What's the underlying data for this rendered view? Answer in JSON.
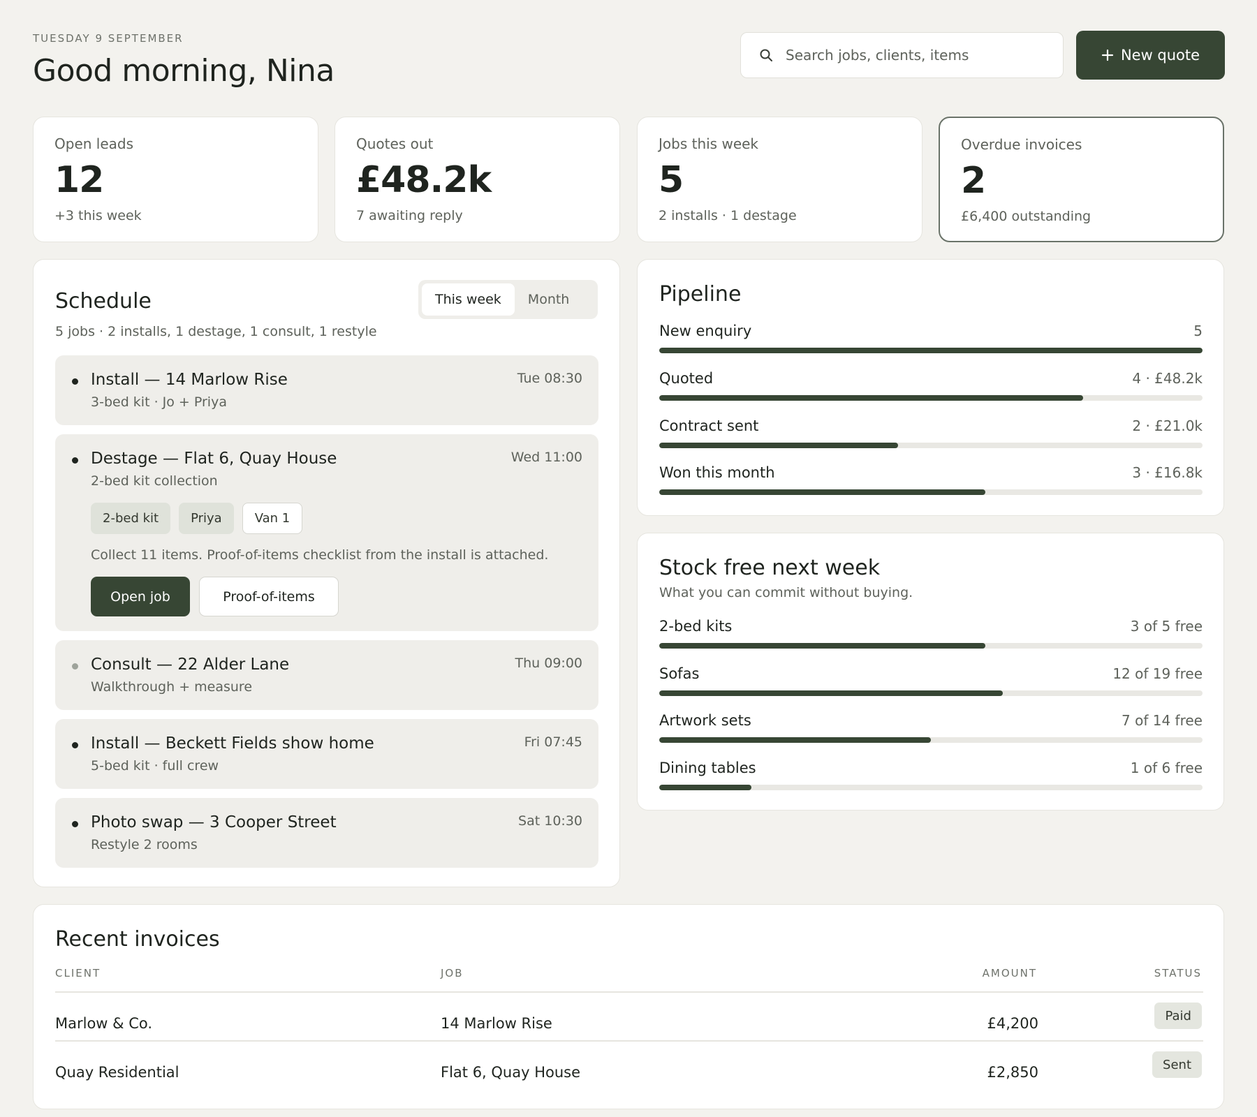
{
  "header": {
    "date": "TUESDAY 9 SEPTEMBER",
    "greeting": "Good morning, Nina",
    "search_placeholder": "Search jobs, clients, items",
    "new_quote_label": "New quote"
  },
  "stats": [
    {
      "label": "Open leads",
      "value": "12",
      "sub": "+3 this week"
    },
    {
      "label": "Quotes out",
      "value": "£48.2k",
      "sub": "7 awaiting reply"
    },
    {
      "label": "Jobs this week",
      "value": "5",
      "sub": "2 installs · 1 destage"
    },
    {
      "label": "Overdue invoices",
      "value": "2",
      "sub": "£6,400 outstanding"
    }
  ],
  "schedule": {
    "title": "Schedule",
    "summary": "5 jobs · 2 installs, 1 destage, 1 consult, 1 restyle",
    "tabs": [
      "This week",
      "Month"
    ],
    "jobs": [
      {
        "title": "Install — 14 Marlow Rise",
        "detail": "3-bed kit · Jo + Priya",
        "time": "Tue 08:30"
      },
      {
        "title": "Destage — Flat 6, Quay House",
        "detail": "2-bed kit collection",
        "time": "Wed 11:00",
        "chips": [
          "2-bed kit",
          "Priya",
          "Van 1"
        ],
        "note": "Collect 11 items. Proof-of-items checklist from the install is attached.",
        "actions": [
          "Open job",
          "Proof-of-items"
        ]
      },
      {
        "title": "Consult — 22 Alder Lane",
        "detail": "Walkthrough + measure",
        "time": "Thu 09:00"
      },
      {
        "title": "Install — Beckett Fields show home",
        "detail": "5-bed kit · full crew",
        "time": "Fri 07:45"
      },
      {
        "title": "Photo swap — 3 Cooper Street",
        "detail": "Restyle 2 rooms",
        "time": "Sat 10:30"
      }
    ]
  },
  "pipeline": {
    "title": "Pipeline",
    "rows": [
      {
        "label": "New enquiry",
        "value": "5",
        "fraction": 1.0
      },
      {
        "label": "Quoted",
        "value": "4 · £48.2k",
        "fraction": 0.78
      },
      {
        "label": "Contract sent",
        "value": "2 · £21.0k",
        "fraction": 0.44
      },
      {
        "label": "Won this month",
        "value": "3 · £16.8k",
        "fraction": 0.6
      }
    ]
  },
  "stock": {
    "title": "Stock free next week",
    "subtitle": "What you can commit without buying.",
    "rows": [
      {
        "label": "2-bed kits",
        "value": "3 of 5 free",
        "fraction": 0.6
      },
      {
        "label": "Sofas",
        "value": "12 of 19 free",
        "fraction": 0.632
      },
      {
        "label": "Artwork sets",
        "value": "7 of 14 free",
        "fraction": 0.5
      },
      {
        "label": "Dining tables",
        "value": "1 of 6 free",
        "fraction": 0.17
      }
    ]
  },
  "invoices": {
    "title": "Recent invoices",
    "columns": [
      "CLIENT",
      "JOB",
      "AMOUNT",
      "STATUS"
    ],
    "rows": [
      {
        "client": "Marlow & Co.",
        "job": "14 Marlow Rise",
        "amount": "£4,200",
        "status": "Paid"
      },
      {
        "client": "Quay Residential",
        "job": "Flat 6, Quay House",
        "amount": "£2,850",
        "status": "Sent"
      }
    ]
  }
}
